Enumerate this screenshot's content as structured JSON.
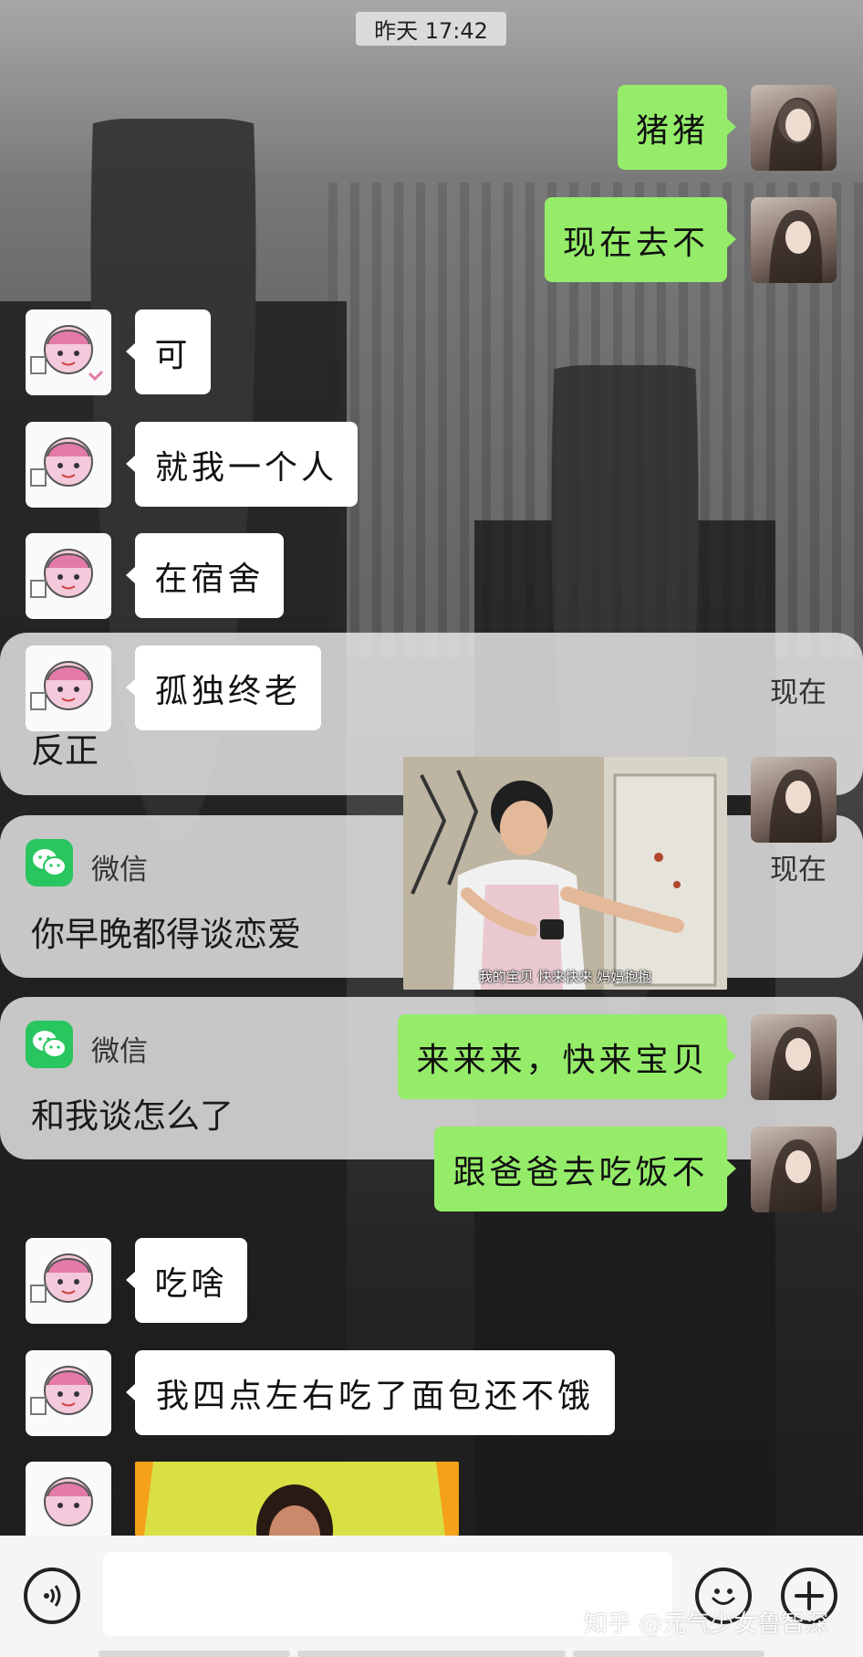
{
  "timestamp": "昨天 17:42",
  "notifications": [
    {
      "app": "",
      "time": "现在",
      "body": "反正"
    },
    {
      "app": "微信",
      "time": "现在",
      "body": "你早晚都得谈恋爱"
    },
    {
      "app": "微信",
      "time": "",
      "body": "和我谈怎么了"
    }
  ],
  "messages": {
    "m1": "猪猪",
    "m2": "现在去不",
    "m3": "可",
    "m4": "就我一个人",
    "m5": "在宿舍",
    "m6": "孤独终老",
    "m7": "来来来，快来宝贝",
    "m8": "跟爸爸去吃饭不",
    "m9": "吃啥",
    "m10": "我四点左右吃了面包还不饿"
  },
  "sticker_caption": "我的宝贝  快来快来  妈妈抱抱",
  "input": {
    "value": "",
    "placeholder": ""
  },
  "watermark": "知乎 @元气少女鲁智深",
  "colors": {
    "outgoing_bubble": "#95ec69",
    "incoming_bubble": "#ffffff",
    "wechat_green": "#29c55f"
  },
  "icons": {
    "voice": "voice-icon",
    "emoji": "emoji-icon",
    "plus": "plus-icon",
    "wechat": "wechat-icon"
  }
}
